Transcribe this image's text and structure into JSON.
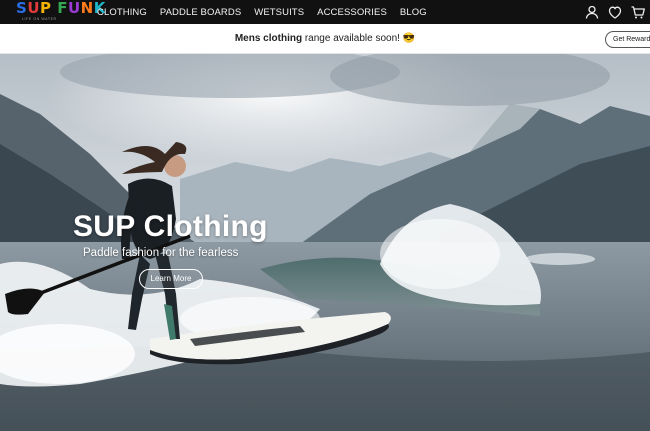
{
  "brand": {
    "logo_text": "SUP FUNK",
    "tagline": "LIFE ON WATER"
  },
  "nav": {
    "items": [
      {
        "label": "CLOTHING"
      },
      {
        "label": "PADDLE BOARDS"
      },
      {
        "label": "WETSUITS"
      },
      {
        "label": "ACCESSORIES"
      },
      {
        "label": "BLOG"
      }
    ],
    "icons": [
      "account-icon",
      "wishlist-heart-icon",
      "cart-icon"
    ]
  },
  "announcement": {
    "bold_text": "Mens clothing",
    "text": " range available soon! 😎",
    "rewards_button": "Get Rewards"
  },
  "hero": {
    "title": "SUP Clothing",
    "subtitle": "Paddle fashion for the fearless",
    "button_label": "Learn More"
  },
  "colors": {
    "nav_background": "#111111",
    "logo_letters": [
      "#2b6de8",
      "#e23b3b",
      "#f4b400",
      "#34a853",
      "#9b3bd6",
      "#ff7a1a",
      "#1fb5c9",
      "#e8408a"
    ]
  }
}
